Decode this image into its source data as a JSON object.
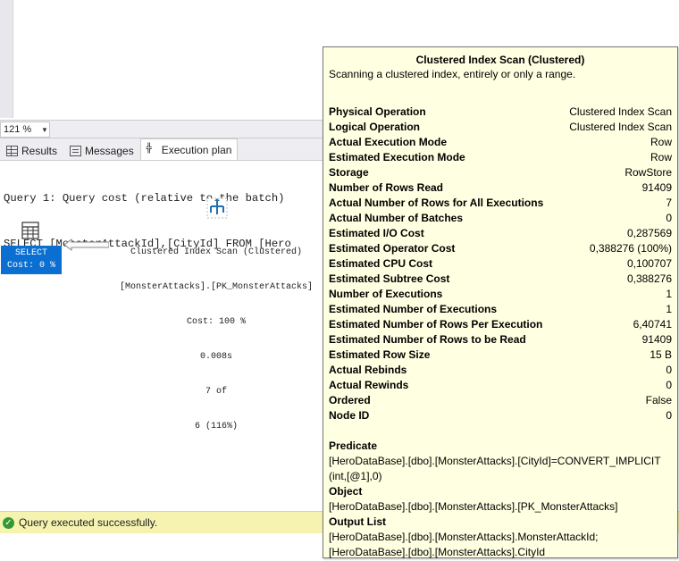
{
  "zoom": {
    "value": "121 %"
  },
  "tabs": [
    {
      "label": "Results",
      "icon": "grid-icon",
      "active": false
    },
    {
      "label": "Messages",
      "icon": "messages-icon",
      "active": false
    },
    {
      "label": "Execution plan",
      "icon": "execution-plan-icon",
      "active": true
    }
  ],
  "query": {
    "line1": "Query 1: Query cost (relative to the batch)",
    "line2": "SELECT [MonsterAttackId],[CityId] FROM [Hero"
  },
  "plan": {
    "select_label": "SELECT",
    "select_cost": "Cost: 0 %",
    "scan_lines": [
      "Clustered Index Scan (Clustered)",
      "[MonsterAttacks].[PK_MonsterAttacks]",
      "Cost: 100 %",
      "0.008s",
      "7 of",
      "6 (116%)"
    ]
  },
  "tooltip": {
    "title": "Clustered Index Scan (Clustered)",
    "subtitle": "Scanning a clustered index, entirely or only a range.",
    "rows": [
      {
        "k": "Physical Operation",
        "v": "Clustered Index Scan"
      },
      {
        "k": "Logical Operation",
        "v": "Clustered Index Scan"
      },
      {
        "k": "Actual Execution Mode",
        "v": "Row"
      },
      {
        "k": "Estimated Execution Mode",
        "v": "Row"
      },
      {
        "k": "Storage",
        "v": "RowStore"
      },
      {
        "k": "Number of Rows Read",
        "v": "91409"
      },
      {
        "k": "Actual Number of Rows for All Executions",
        "v": "7"
      },
      {
        "k": "Actual Number of Batches",
        "v": "0"
      },
      {
        "k": "Estimated I/O Cost",
        "v": "0,287569"
      },
      {
        "k": "Estimated Operator Cost",
        "v": "0,388276 (100%)"
      },
      {
        "k": "Estimated CPU Cost",
        "v": "0,100707"
      },
      {
        "k": "Estimated Subtree Cost",
        "v": "0,388276"
      },
      {
        "k": "Number of Executions",
        "v": "1"
      },
      {
        "k": "Estimated Number of Executions",
        "v": "1"
      },
      {
        "k": "Estimated Number of Rows Per Execution",
        "v": "6,40741"
      },
      {
        "k": "Estimated Number of Rows to be Read",
        "v": "91409"
      },
      {
        "k": "Estimated Row Size",
        "v": "15 B"
      },
      {
        "k": "Actual Rebinds",
        "v": "0"
      },
      {
        "k": "Actual Rewinds",
        "v": "0"
      },
      {
        "k": "Ordered",
        "v": "False"
      },
      {
        "k": "Node ID",
        "v": "0"
      }
    ],
    "predicate_label": "Predicate",
    "predicate_text": "[HeroDataBase].[dbo].[MonsterAttacks].[CityId]=CONVERT_IMPLICIT (int,[@1],0)",
    "object_label": "Object",
    "object_text": "[HeroDataBase].[dbo].[MonsterAttacks].[PK_MonsterAttacks]",
    "output_label": "Output List",
    "output_line1": "[HeroDataBase].[dbo].[MonsterAttacks].MonsterAttackId;",
    "output_line2": "[HeroDataBase].[dbo].[MonsterAttacks].CityId"
  },
  "status": {
    "text": "Query executed successfully.",
    "icon": "check-icon",
    "color": "#f6f3b0"
  }
}
